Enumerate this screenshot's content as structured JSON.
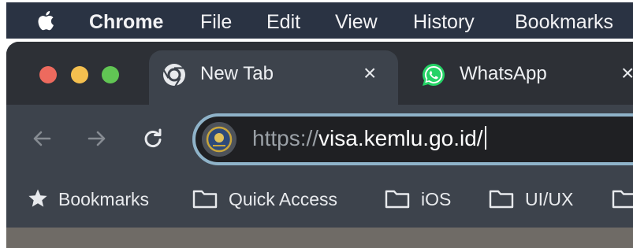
{
  "menubar": {
    "apple_icon": "apple-logo-icon",
    "items": [
      "Chrome",
      "File",
      "Edit",
      "View",
      "History",
      "Bookmarks"
    ]
  },
  "window": {
    "traffic_lights": {
      "close": "#ed6a5e",
      "minimize": "#f4bf4f",
      "zoom": "#61c554"
    },
    "tabs": [
      {
        "label": "New Tab",
        "icon": "chrome-icon",
        "active": true,
        "close": "×"
      },
      {
        "label": "WhatsApp",
        "icon": "whatsapp-icon",
        "active": false,
        "close": "×"
      }
    ]
  },
  "toolbar": {
    "back_icon": "back-arrow-icon",
    "forward_icon": "forward-arrow-icon",
    "reload_icon": "reload-icon",
    "address": {
      "scheme": "https://",
      "host": "visa.kemlu.go.id/",
      "site_icon": "site-emblem-icon"
    }
  },
  "bookmarks_bar": {
    "items": [
      {
        "label": "Bookmarks",
        "icon": "star-icon"
      },
      {
        "label": "Quick Access",
        "icon": "folder-icon"
      },
      {
        "label": "iOS",
        "icon": "folder-icon"
      },
      {
        "label": "UI/UX",
        "icon": "folder-icon"
      },
      {
        "label": "",
        "icon": "folder-icon"
      }
    ]
  },
  "colors": {
    "menubar_bg": "#2a3343",
    "tabstrip_bg": "#2d3036",
    "toolbar_bg": "#3d434c",
    "omnibox_border": "#8fb3c9"
  }
}
